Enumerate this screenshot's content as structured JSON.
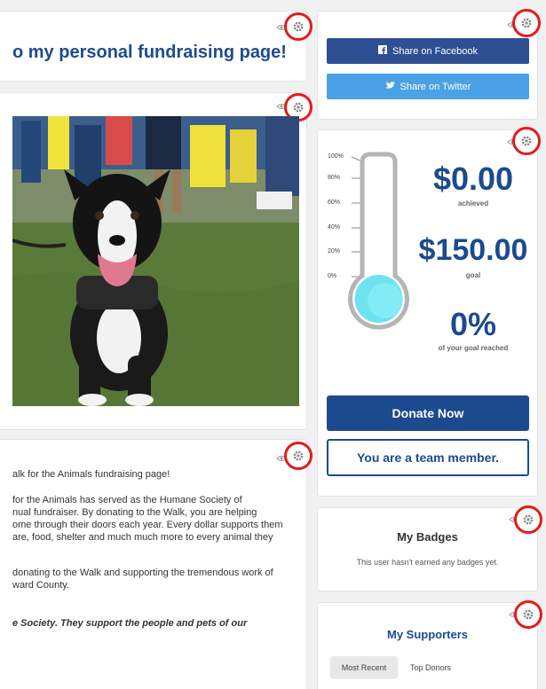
{
  "welcome": {
    "title": "o my personal fundraising page!"
  },
  "story": {
    "lines": [
      "alk for the Animals fundraising page!",
      " for the Animals has served as the Humane Society of",
      "nual fundraiser. By donating to the Walk, you are helping",
      "ome through their doors each year. Every dollar supports them",
      "are, food, shelter and much much more to every animal they",
      "donating to the Walk and supporting the tremendous work of",
      "ward County.",
      "e Society. They support the people and pets of our"
    ]
  },
  "share": {
    "facebook_label": "Share on Facebook",
    "twitter_label": "Share on Twitter"
  },
  "progress": {
    "scale_labels": [
      "100%",
      "80%",
      "60%",
      "40%",
      "20%",
      "0%"
    ],
    "fill_percent": 0,
    "achieved_amount": "$0.00",
    "achieved_label": "achieved",
    "goal_amount": "$150.00",
    "goal_label": "goal",
    "percent_value": "0%",
    "percent_label": "of your goal reached",
    "donate_label": "Donate Now",
    "team_label": "You are a team member."
  },
  "badges": {
    "title": "My Badges",
    "empty_text": "This user hasn't earned any badges yet."
  },
  "supporters": {
    "title": "My Supporters",
    "tabs": [
      "Most Recent",
      "Top Donors"
    ]
  },
  "colors": {
    "brand_blue": "#1c4a8f",
    "facebook": "#2f4f93",
    "twitter": "#4aa1e5",
    "highlight": "#e41b1b"
  }
}
